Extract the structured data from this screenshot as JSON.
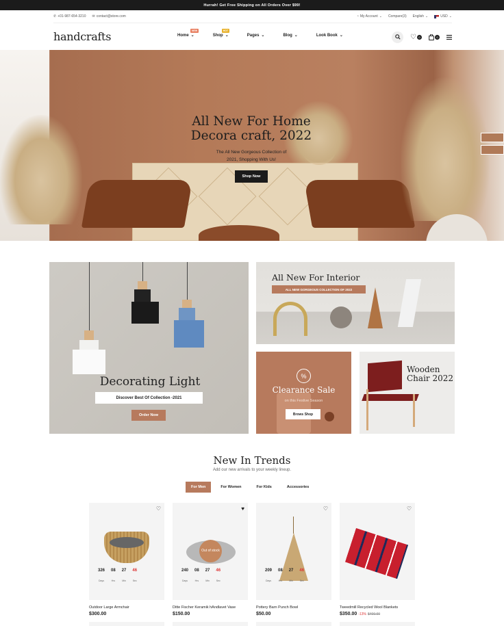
{
  "announcement": "Hurrah! Get Free Shipping on All Orders Over $99!",
  "topbar": {
    "phone": "+01-987-654-3210",
    "email": "contact@store.com",
    "account": "My Account",
    "compare": "Compare(3)",
    "language": "English",
    "currency": "USD"
  },
  "header": {
    "logo": "handcrafts",
    "nav": [
      {
        "label": "Home",
        "badge": "NEW",
        "badge_color": "#e87d5e"
      },
      {
        "label": "Shop",
        "badge": "HOT",
        "badge_color": "#e8b12a"
      },
      {
        "label": "Pages"
      },
      {
        "label": "Blog"
      },
      {
        "label": "Look Book"
      }
    ],
    "wishlist_count": "0",
    "cart_count": "0"
  },
  "hero": {
    "title_line1": "All New For Home",
    "title_line2": "Decora craft, 2022",
    "subtitle_line1": "The All New Gorgeous Collection of",
    "subtitle_line2": "2021, Shopping With Us!",
    "button": "Shop Now"
  },
  "banners": {
    "lighting": {
      "title": "Decorating Light",
      "subtitle": "Discover Best Of Collection -2021",
      "button": "Order Now"
    },
    "interior": {
      "title": "All New For Interior",
      "subtitle": "ALL NEW GORGEOUS COLLECTION OF 2022"
    },
    "clearance": {
      "title": "Clearance Sale",
      "subtitle": "on this Festive Season",
      "button": "Brows Shop",
      "icon": "%"
    },
    "chair": {
      "title_line1": "Wooden",
      "title_line2": "Chair 2022"
    }
  },
  "trends": {
    "title": "New In Trends",
    "subtitle": "Add our new arrivals to your weekly lineup.",
    "tabs": [
      "For Men",
      "For Women",
      "For Kids",
      "Accessories"
    ],
    "active_tab": "For Men",
    "countdown_units": [
      "Days",
      "Hrs",
      "Min",
      "Sec"
    ],
    "products": [
      {
        "name": "Outdoor Large Armchair",
        "price": "$300.00",
        "timer": [
          "326",
          "08",
          "27",
          "46"
        ],
        "wishlisted": false
      },
      {
        "name": "Ditte Fischer Keramik hAndlavet Vase",
        "price": "$150.00",
        "timer": [
          "240",
          "08",
          "27",
          "46"
        ],
        "wishlisted": true,
        "out_of_stock": "Out of stock"
      },
      {
        "name": "Pottery Barn Punch Bowl",
        "price": "$50.00",
        "timer": [
          "209",
          "08",
          "27",
          "46"
        ],
        "wishlisted": false
      },
      {
        "name": "Tweedmill Recycled Wool Blankets",
        "price": "$350.00",
        "discount": "-13%",
        "old_price": "$400.00",
        "wishlisted": false
      }
    ]
  },
  "colors": {
    "accent": "#b77a5d",
    "dark": "#1b1b1b",
    "sale_red": "#d33333"
  }
}
